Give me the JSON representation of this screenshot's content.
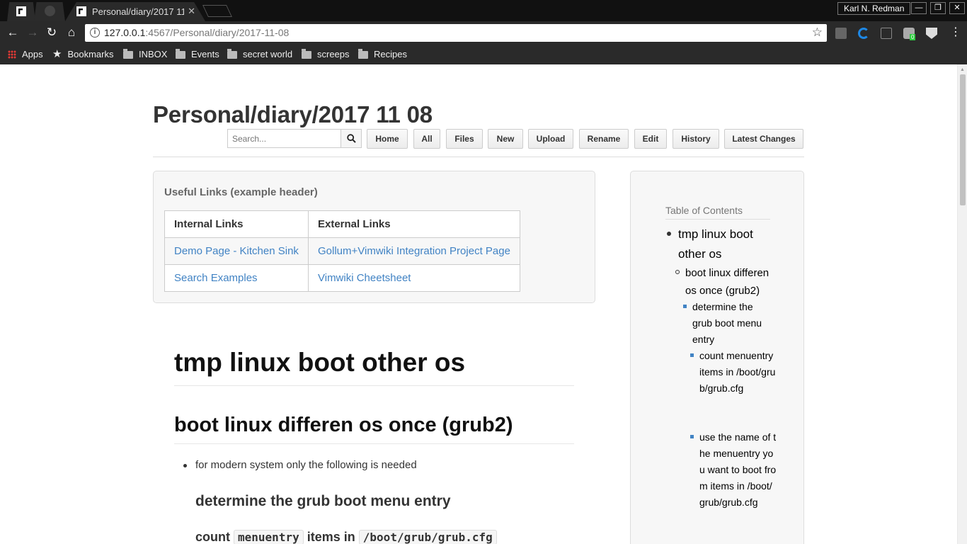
{
  "browser": {
    "tabs": [
      {
        "title": "Personal/diary/2017 11 08",
        "active": true,
        "close": "✕"
      }
    ],
    "profile_name": "Karl N. Redman",
    "url_host": "127.0.0.1",
    "url_rest": ":4567/Personal/diary/2017-11-08",
    "bookmarks": [
      {
        "label": "Apps",
        "icon": "apps-grid-icon"
      },
      {
        "label": "Bookmarks",
        "icon": "star-icon"
      },
      {
        "label": "INBOX",
        "icon": "folder-icon"
      },
      {
        "label": "Events",
        "icon": "folder-icon"
      },
      {
        "label": "secret world",
        "icon": "folder-icon"
      },
      {
        "label": "screeps",
        "icon": "folder-icon"
      },
      {
        "label": "Recipes",
        "icon": "folder-icon"
      }
    ],
    "extension_badge": "0"
  },
  "page": {
    "title": "Personal/diary/2017 11 08",
    "search_placeholder": "Search...",
    "buttons": {
      "home": "Home",
      "all": "All",
      "files": "Files",
      "new": "New",
      "upload": "Upload",
      "rename": "Rename",
      "edit": "Edit",
      "history": "History",
      "latest_changes": "Latest Changes"
    },
    "useful_links": {
      "header": "Useful Links (example header)",
      "columns": [
        "Internal Links",
        "External Links"
      ],
      "rows": [
        [
          "Demo Page - Kitchen Sink",
          "Gollum+Vimwiki Integration Project Page"
        ],
        [
          "Search Examples",
          "Vimwiki Cheetsheet"
        ]
      ]
    },
    "content": {
      "h1": "tmp linux boot other os",
      "h2": "boot linux differen os once (grub2)",
      "bullet": "for modern system only the following is needed",
      "h3": "determine the grub boot menu entry",
      "h4_prefix": "count",
      "h4_code1": "menuentry",
      "h4_mid": "items in",
      "h4_code2": "/boot/grub/grub.cfg"
    },
    "toc": {
      "title": "Table of Contents",
      "l1": "tmp linux boot other os",
      "l2": "boot linux differen os once (grub2)",
      "l3": "determine the grub boot menu entry",
      "l4a": "count menuentry items in /boot/grub/grub.cfg",
      "l4b": "use the name of the menuentry you want to boot from items in /boot/grub/grub.cfg"
    }
  }
}
